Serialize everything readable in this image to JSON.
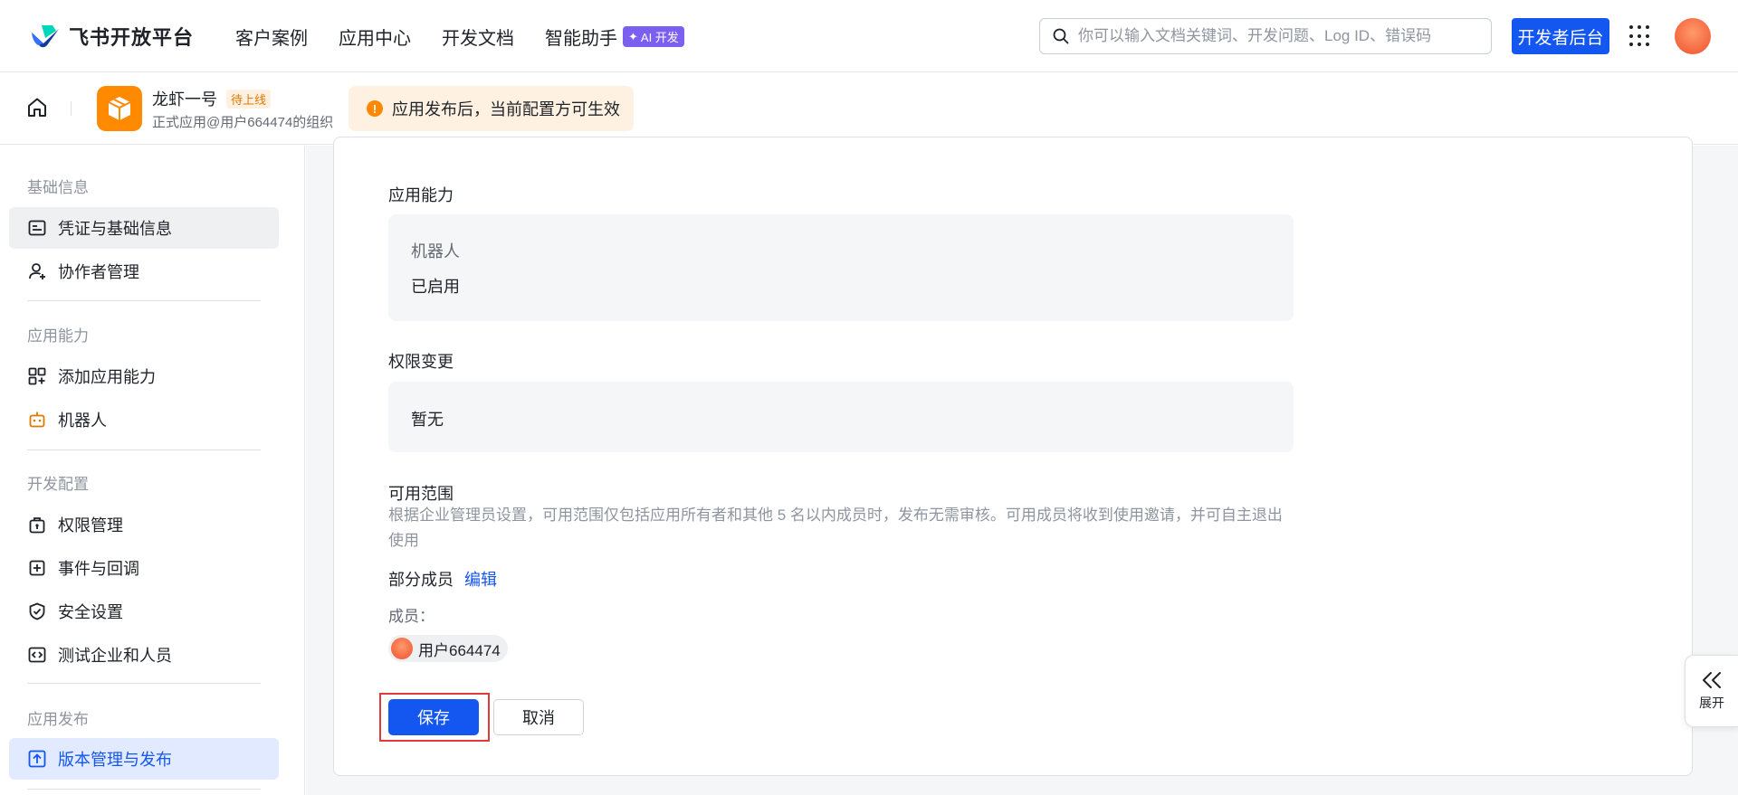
{
  "topnav": {
    "brand": "飞书开放平台",
    "links": [
      "客户案例",
      "应用中心",
      "开发文档",
      "智能助手"
    ],
    "ai_badge": "AI 开发",
    "search_placeholder": "你可以输入文档关键词、开发问题、Log ID、错误码",
    "dev_console_label": "开发者后台"
  },
  "app": {
    "name": "龙虾一号",
    "status": "待上线",
    "org": "正式应用@用户664474的组织",
    "notice": "应用发布后，当前配置方可生效"
  },
  "sidebar": {
    "sections": [
      {
        "title": "基础信息",
        "items": [
          "凭证与基础信息",
          "协作者管理"
        ]
      },
      {
        "title": "应用能力",
        "items": [
          "添加应用能力",
          "机器人"
        ]
      },
      {
        "title": "开发配置",
        "items": [
          "权限管理",
          "事件与回调",
          "安全设置",
          "测试企业和人员"
        ]
      },
      {
        "title": "应用发布",
        "items": [
          "版本管理与发布"
        ]
      }
    ]
  },
  "main": {
    "capability_title": "应用能力",
    "capability_label": "机器人",
    "capability_value": "已启用",
    "permission_title": "权限变更",
    "permission_value": "暂无",
    "scope_title": "可用范围",
    "scope_desc": "根据企业管理员设置，可用范围仅包括应用所有者和其他 5 名以内成员时，发布无需审核。可用成员将收到使用邀请，并可自主退出使用",
    "partial_members": "部分成员",
    "edit_label": "编辑",
    "members_label": "成员：",
    "member_name": "用户664474",
    "save_label": "保存",
    "cancel_label": "取消"
  },
  "expand_label": "展开",
  "colors": {
    "primary": "#1456f0",
    "warning": "#ff8800",
    "highlight_border": "#e03a3a"
  }
}
